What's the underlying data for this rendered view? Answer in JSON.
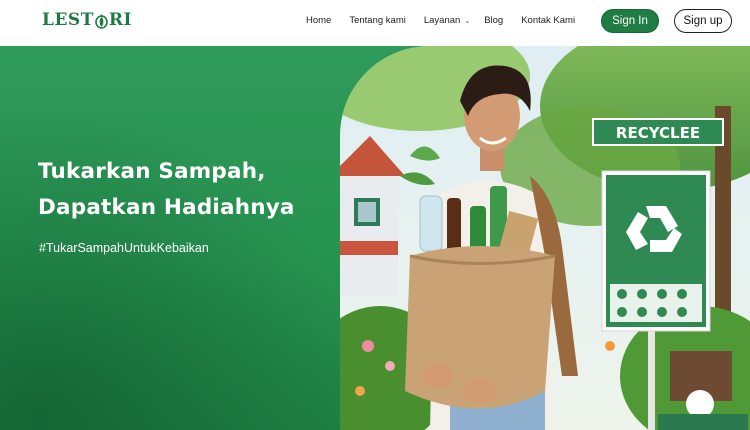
{
  "header": {
    "logo_text_left": "LEST",
    "logo_text_right": "RI",
    "nav": [
      {
        "label": "Home"
      },
      {
        "label": "Tentang kami"
      },
      {
        "label": "Layanan",
        "has_dropdown": true
      },
      {
        "label": "Blog"
      },
      {
        "label": "Kontak Kami"
      }
    ],
    "signin_label": "Sign In",
    "signup_label": "Sign up"
  },
  "hero": {
    "title_line1": "Tukarkan Sampah,",
    "title_line2": "Dapatkan Hadiahnya",
    "hashtag": "#TukarSampahUntukKebaikan",
    "sign_text": "RECYCLEE"
  },
  "colors": {
    "brand_green": "#1f7c44",
    "hero_green": "#2b9655"
  }
}
